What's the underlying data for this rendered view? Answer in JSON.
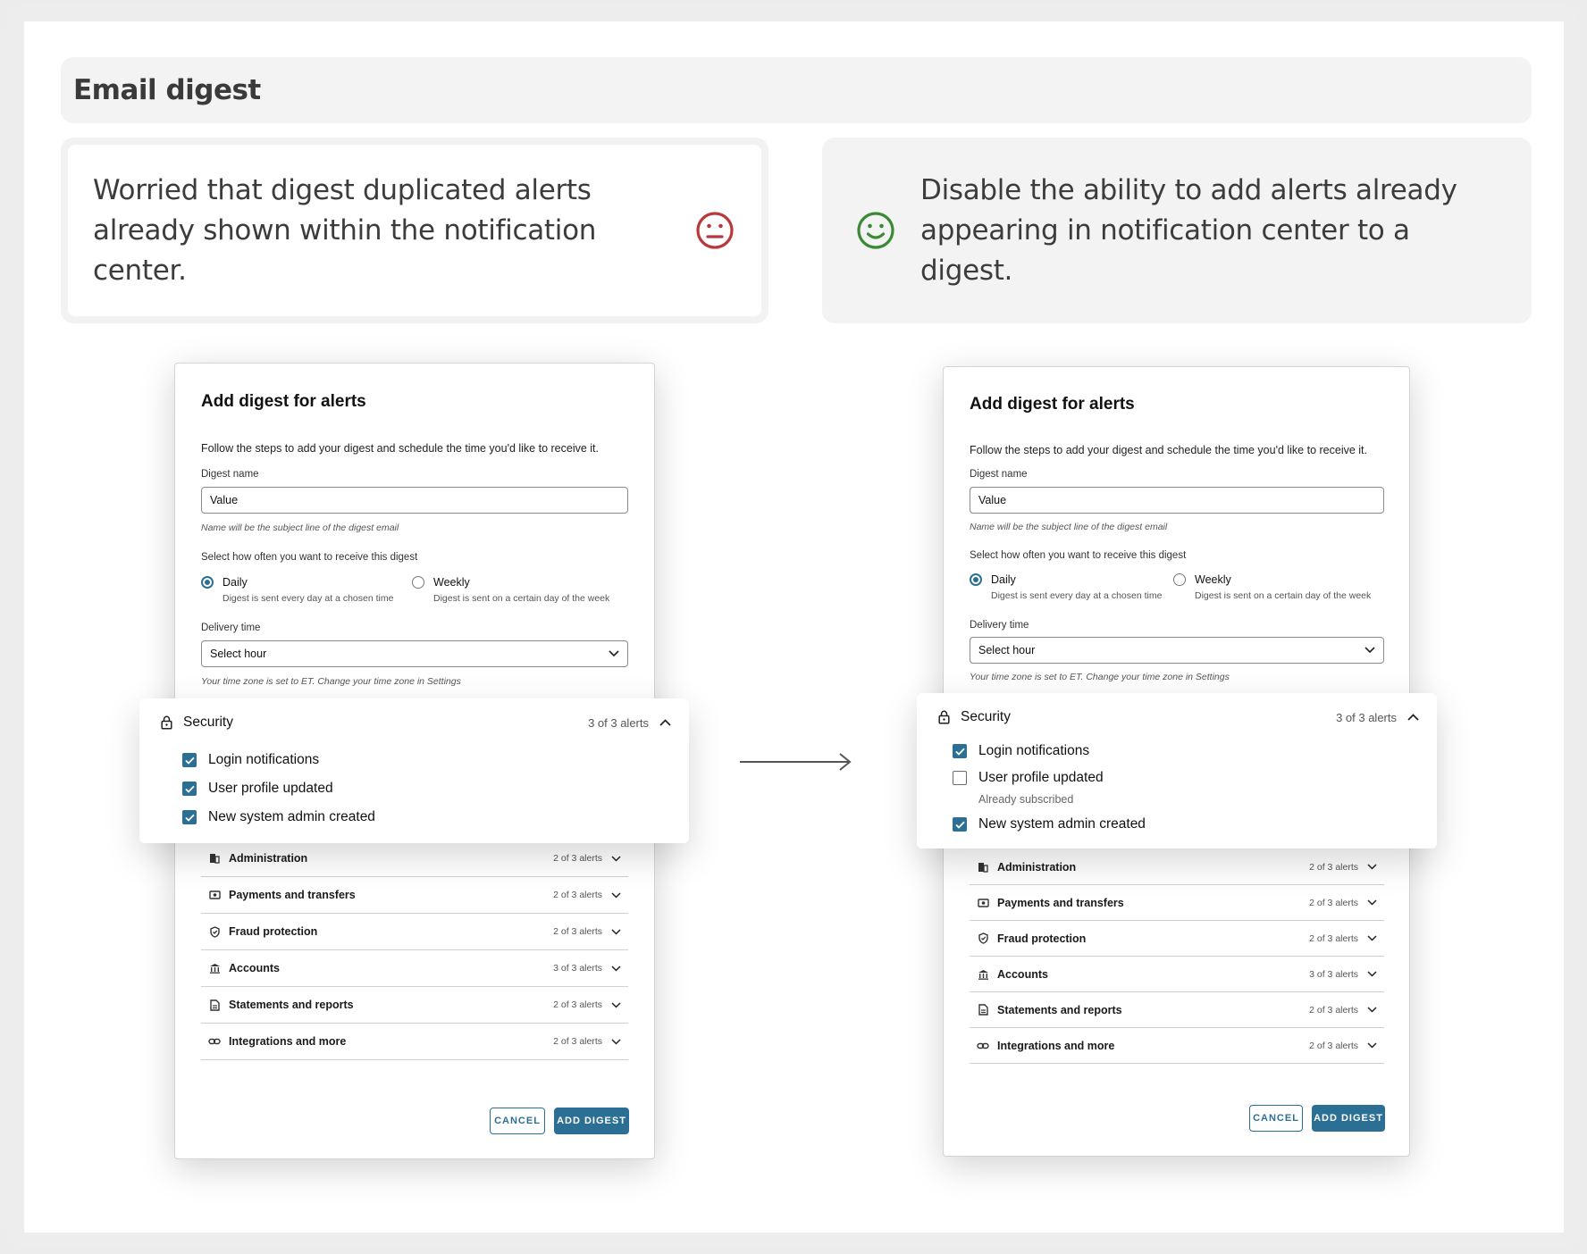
{
  "header": {
    "title": "Email digest"
  },
  "problem_card": {
    "text": "Worried that digest duplicated alerts already shown within the notification center.",
    "icon": "neutral-face-icon",
    "color": "#b8383c"
  },
  "solution_card": {
    "text": "Disable the ability to add alerts already appearing in notification center to a digest.",
    "icon": "smile-face-icon",
    "color": "#3a8a34"
  },
  "modal": {
    "title": "Add digest for alerts",
    "description": "Follow the steps to add your digest and schedule the time you'd like to receive it.",
    "digest_name_label": "Digest name",
    "digest_name_value": "Value",
    "digest_name_help": "Name will be the subject line of the digest email",
    "frequency_label": "Select how often you want to receive this digest",
    "daily_label": "Daily",
    "daily_help": "Digest is sent every day at a chosen time",
    "weekly_label": "Weekly",
    "weekly_help": "Digest is sent on a certain day of the week",
    "delivery_label": "Delivery time",
    "delivery_value": "Select hour",
    "timezone_help": "Your time zone is set to ET. Change your time zone in Settings",
    "cancel_label": "CANCEL",
    "add_label": "ADD DIGEST",
    "accent": "#2c6f95"
  },
  "categories_before": [
    {
      "name": "Administration",
      "count": "2 of 3 alerts",
      "icon": "building-icon"
    },
    {
      "name": "Payments and transfers",
      "count": "2 of 3 alerts",
      "icon": "money-icon"
    },
    {
      "name": "Fraud protection",
      "count": "2 of 3 alerts",
      "icon": "shield-icon"
    },
    {
      "name": "Accounts",
      "count": "3 of 3 alerts",
      "icon": "bank-icon"
    },
    {
      "name": "Statements and reports",
      "count": "2 of 3 alerts",
      "icon": "document-icon"
    },
    {
      "name": "Integrations and more",
      "count": "2 of 3 alerts",
      "icon": "link-icon"
    }
  ],
  "categories_after": [
    {
      "name": "Administration",
      "count": "2 of 3 alerts",
      "icon": "building-icon"
    },
    {
      "name": "Payments and transfers",
      "count": "2 of 3 alerts",
      "icon": "money-icon"
    },
    {
      "name": "Fraud protection",
      "count": "2 of 3 alerts",
      "icon": "shield-icon"
    },
    {
      "name": "Accounts",
      "count": "3 of 3 alerts",
      "icon": "bank-icon"
    },
    {
      "name": "Statements and reports",
      "count": "2 of 3 alerts",
      "icon": "document-icon"
    },
    {
      "name": "Integrations and more",
      "count": "2 of 3 alerts",
      "icon": "link-icon"
    }
  ],
  "security_before": {
    "title": "Security",
    "count": "3 of 3 alerts",
    "items": [
      {
        "label": "Login notifications",
        "checked": true
      },
      {
        "label": "User profile updated",
        "checked": true
      },
      {
        "label": "New system admin created",
        "checked": true
      }
    ]
  },
  "security_after": {
    "title": "Security",
    "count": "3 of 3 alerts",
    "items": [
      {
        "label": "Login notifications",
        "checked": true
      },
      {
        "label": "User profile updated",
        "checked": false,
        "note": "Already subscribed"
      },
      {
        "label": "New system admin created",
        "checked": true
      }
    ]
  }
}
